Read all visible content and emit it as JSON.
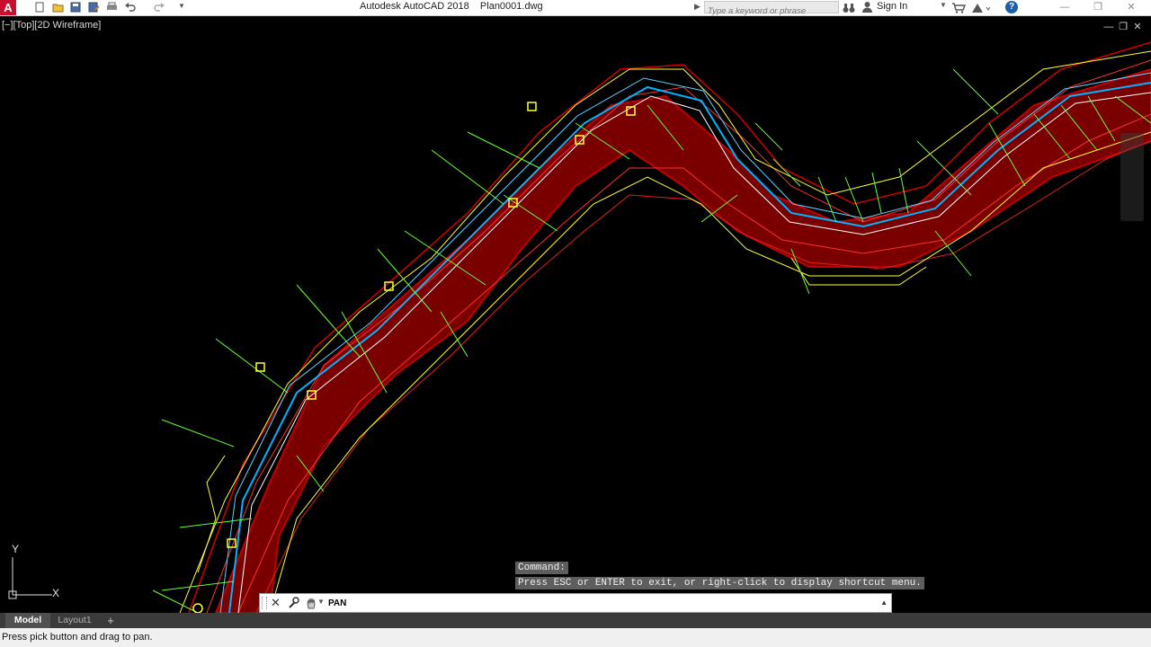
{
  "window": {
    "title": "Autodesk AutoCAD 2018    Plan0001.dwg",
    "app_logo": "A",
    "controls": [
      "—",
      "❐",
      "✕"
    ]
  },
  "search": {
    "placeholder": "Type a keyword or phrase"
  },
  "account": {
    "signin_label": "Sign In"
  },
  "viewport": {
    "label": "[−][Top][2D Wireframe]"
  },
  "ucs": {
    "x_label": "X",
    "y_label": "Y"
  },
  "command": {
    "history": [
      "Command:",
      "Press ESC or ENTER to exit, or right-click to display shortcut menu."
    ],
    "current": "PAN"
  },
  "tabs": {
    "model": "Model",
    "layout1": "Layout1",
    "add": "+"
  },
  "status": {
    "text": "Press pick button and drag to pan."
  },
  "colors": {
    "canvas": "#000000",
    "contours": "#c00000",
    "alignment": "#00b4ff",
    "edges": "#ffff33",
    "sections": "#66ff33"
  },
  "icons": [
    "new-icon",
    "open-icon",
    "save-icon",
    "saveas-icon",
    "print-icon",
    "undo-icon",
    "redo-icon",
    "binocular-icon",
    "user-icon",
    "cart-icon",
    "exchange-icon",
    "help-icon",
    "pan-hand-icon",
    "wrench-icon",
    "close-icon"
  ]
}
